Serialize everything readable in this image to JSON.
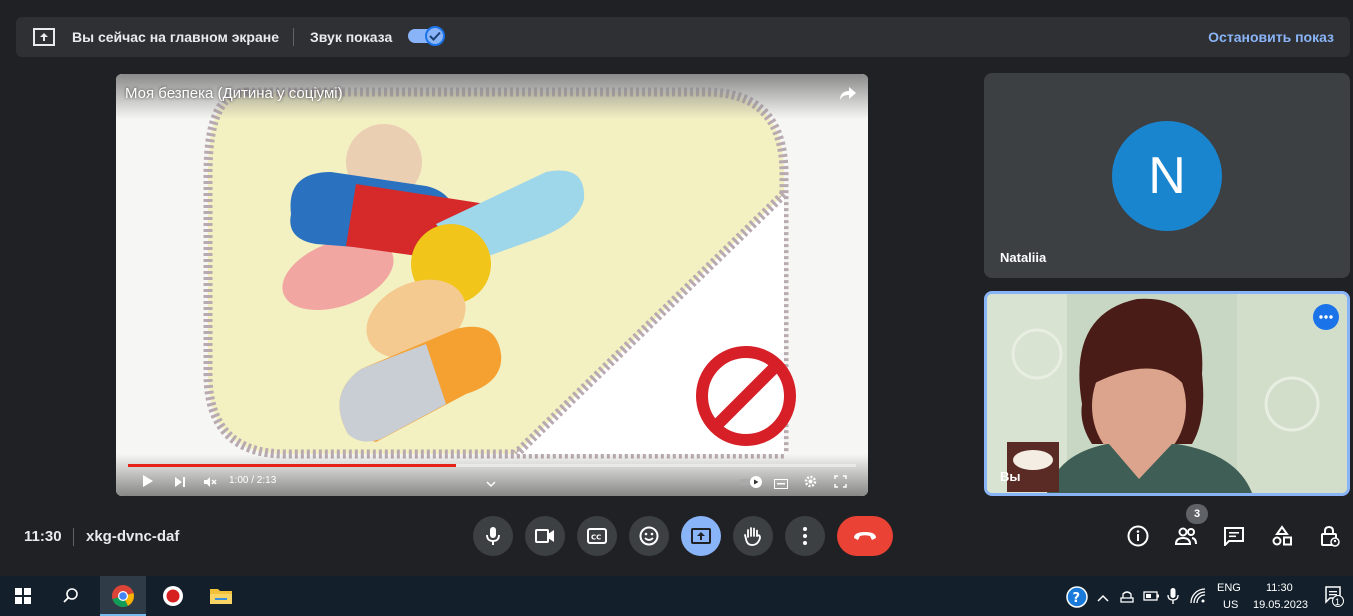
{
  "banner": {
    "status_text": "Вы сейчас на главном экране",
    "sound_label": "Звук показа",
    "sound_enabled": true,
    "stop_label": "Остановить показ"
  },
  "video": {
    "title": "Моя безпека (Дитина у соціумі)",
    "time": "1:00 / 2:13",
    "progress": 0.45
  },
  "participants": [
    {
      "name": "Nataliia",
      "initial": "N",
      "avatar_color": "#1a85cf"
    },
    {
      "name": "Вы"
    }
  ],
  "meeting": {
    "clock": "11:30",
    "code": "xkg-dvnc-daf",
    "people_count": "3"
  },
  "taskbar": {
    "lang": "ENG",
    "region": "US",
    "time": "11:30",
    "date": "19.05.2023",
    "notifications": "1"
  },
  "colors": {
    "background": "#202124",
    "accent": "#8ab4f8",
    "end_call": "#ea4335"
  }
}
